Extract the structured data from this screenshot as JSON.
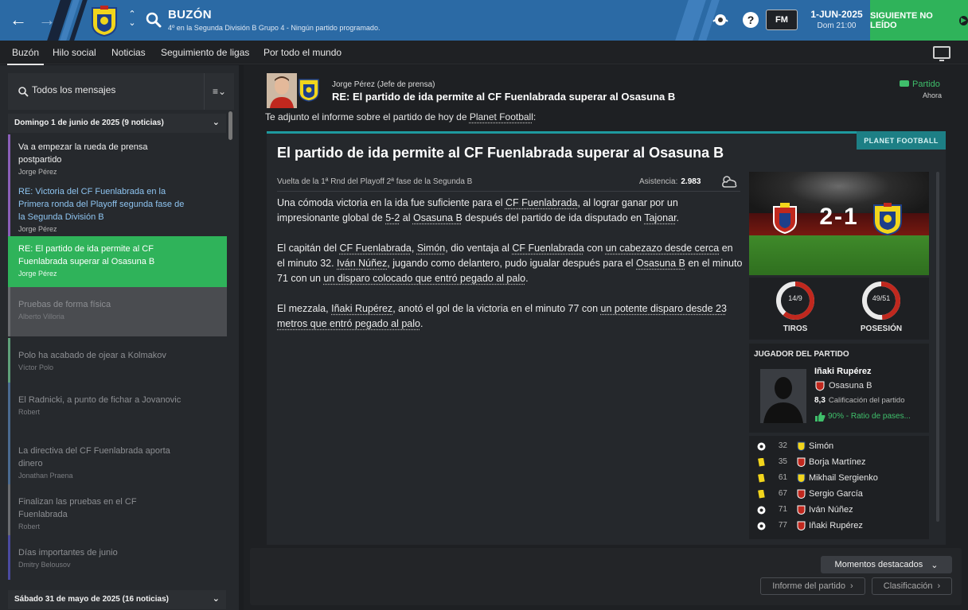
{
  "topbar": {
    "title": "BUZÓN",
    "subtitle": "4º en la Segunda División B Grupo 4 - Ningún partido programado.",
    "fm_label": "FM",
    "date": "1-JUN-2025",
    "day_time": "Dom 21:00",
    "next_label": "SIGUIENTE NO LEÍDO"
  },
  "tabs": [
    {
      "label": "Buzón"
    },
    {
      "label": "Hilo social"
    },
    {
      "label": "Noticias"
    },
    {
      "label": "Seguimiento de ligas"
    },
    {
      "label": "Por todo el mundo"
    }
  ],
  "inbox": {
    "filter_label": "Todos los mensajes",
    "group1_label": "Domingo 1 de junio de 2025 (9 noticias)",
    "group2_label": "Sábado 31 de mayo de 2025 (16 noticias)",
    "messages": [
      {
        "subject": "Va a empezar la rueda de prensa postpartido",
        "sender": "Jorge Pérez"
      },
      {
        "subject": "RE: Victoria del CF Fuenlabrada en la Primera ronda del Playoff segunda fase de la Segunda División B",
        "sender": "Jorge Pérez"
      },
      {
        "subject": "RE: El partido de ida permite al CF Fuenlabrada superar al Osasuna B",
        "sender": "Jorge Pérez"
      },
      {
        "subject": "Pruebas de forma física",
        "sender": "Alberto Villoria"
      },
      {
        "subject": "Polo ha acabado de ojear a Kolmakov",
        "sender": "Víctor Polo"
      },
      {
        "subject": "El Radnicki, a punto de fichar a Jovanovic",
        "sender": "Robert"
      },
      {
        "subject": "La directiva del CF Fuenlabrada aporta dinero",
        "sender": "Jonathan Praena"
      },
      {
        "subject": "Finalizan las pruebas en el CF Fuenlabrada",
        "sender": "Robert"
      },
      {
        "subject": "Días importantes de junio",
        "sender": "Dmitry Belousov"
      }
    ]
  },
  "message": {
    "sender": "Jorge Pérez  (Jefe de prensa)",
    "title": "RE: El partido de ida permite al CF Fuenlabrada superar al Osasuna B",
    "tag": "Partido",
    "time": "Ahora",
    "intro_a": "Te adjunto el informe sobre el partido de hoy de ",
    "intro_link": "Planet Football",
    "intro_b": ":"
  },
  "article": {
    "source": "PLANET FOOTBALL",
    "headline": "El partido de ida permite al CF Fuenlabrada superar al Osasuna B",
    "round": "Vuelta de la 1ª Rnd del Playoff 2ª fase de la Segunda B",
    "attendance_label": "Asistencia:",
    "attendance": "2.983",
    "p1": {
      "a": "Una cómoda victoria en la ida fue suficiente para el ",
      "club": "CF Fuenlabrada",
      "b": ", al lograr ganar por un impresionante global de ",
      "agg": "5-2",
      "c": " al ",
      "opp": "Osasuna B",
      "d": " después del partido de ida disputado en ",
      "venue": "Tajonar",
      "e": "."
    },
    "p2": {
      "a": "El capitán del ",
      "club": "CF Fuenlabrada",
      "b": ", ",
      "cap": "Simón",
      "c": ", dio ventaja al ",
      "club2": "CF Fuenlabrada",
      "d": " con ",
      "goal1": "un cabezazo desde cerca",
      "e": " en el minuto 32. ",
      "p": "Iván Núñez",
      "f": ", jugando como delantero, pudo igualar después para el ",
      "opp": "Osasuna B",
      "g": " en el minuto 71 con un ",
      "goal2": "un disparo colocado que entró pegado al palo",
      "h": "."
    },
    "p3": {
      "a": "El mezzala, ",
      "p": "Iñaki Rupérez",
      "b": ", anotó el gol de la victoria en el minuto 77 con ",
      "goal": "un potente disparo desde 23 metros que entró pegado al palo",
      "c": "."
    }
  },
  "score": {
    "text": "2-1"
  },
  "stats": [
    {
      "label": "TIROS",
      "value": "14/9",
      "home_share": 0.61,
      "color": "#c0281e"
    },
    {
      "label": "POSESIÓN",
      "value": "49/51",
      "home_share": 0.49,
      "color": "#c0281e"
    }
  ],
  "motm": {
    "heading": "JUGADOR DEL PARTIDO",
    "name": "Iñaki Rupérez",
    "club": "Osasuna B",
    "rating": "8,3",
    "rating_label": "Calificación del partido",
    "pass": "90% - Ratio de pases..."
  },
  "events": [
    {
      "type": "goal",
      "minute": "32",
      "team": "home",
      "name": "Simón"
    },
    {
      "type": "yellow",
      "minute": "35",
      "team": "away",
      "name": "Borja Martínez"
    },
    {
      "type": "yellow",
      "minute": "61",
      "team": "home",
      "name": "Mikhail Sergienko"
    },
    {
      "type": "yellow",
      "minute": "67",
      "team": "away",
      "name": "Sergio García"
    },
    {
      "type": "goal",
      "minute": "71",
      "team": "away",
      "name": "Iván Núñez"
    },
    {
      "type": "goal",
      "minute": "77",
      "team": "away",
      "name": "Iñaki Rupérez"
    }
  ],
  "actions": {
    "moments": "Momentos destacados",
    "report": "Informe del partido",
    "table": "Clasificación"
  },
  "colors": {
    "topbar": "#2b6aa5",
    "accent_green": "#2fb35a",
    "article_accent": "#1e9a9f",
    "home_red": "#c0281e",
    "away_yellow": "#f2d51c"
  }
}
